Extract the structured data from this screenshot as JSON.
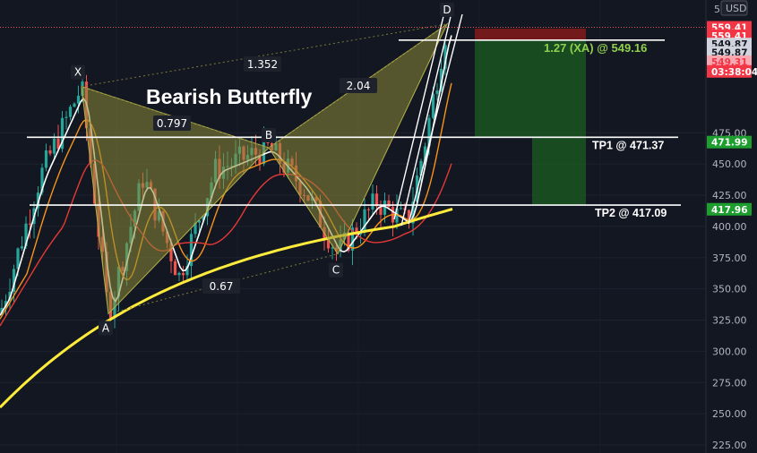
{
  "chart_data": {
    "type": "candlestick",
    "title": "Bearish Butterfly",
    "currency": "USD",
    "y_axis_top_label": "5",
    "ylim": [
      222,
      575
    ],
    "y_ticks": [
      225,
      250,
      275,
      300,
      325,
      350,
      375,
      400,
      425,
      450,
      475
    ],
    "pattern_points": [
      {
        "label": "X",
        "price": 512
      },
      {
        "label": "A",
        "price": 330
      },
      {
        "label": "B",
        "price": 463
      },
      {
        "label": "C",
        "price": 378
      },
      {
        "label": "D",
        "price": 562
      }
    ],
    "ratios": [
      "0.797",
      "1.352",
      "2.04",
      "0.67"
    ],
    "price_tags": [
      {
        "text": "559.41",
        "price": 559.41,
        "style": "red"
      },
      {
        "text": "559.41",
        "price": 552.7,
        "style": "red"
      },
      {
        "text": "549.87",
        "price": 546.0,
        "style": "gray"
      },
      {
        "text": "549.87",
        "price": 539.3,
        "style": "gray"
      },
      {
        "text": "549.31",
        "price": 531.9,
        "style": "pink"
      },
      {
        "text": "03:38:04",
        "price": 524.1,
        "style": "red"
      },
      {
        "text": "471.99",
        "price": 467.5,
        "style": "green"
      },
      {
        "text": "417.96",
        "price": 413.7,
        "style": "green"
      }
    ],
    "levels": [
      {
        "name": "target",
        "price": 549.16,
        "label": "1.27 (XA) @ 549.16"
      },
      {
        "name": "tp1",
        "price": 471.37,
        "label": "TP1 @ 471.37"
      },
      {
        "name": "tp2",
        "price": 417.09,
        "label": "TP2 @ 417.09"
      }
    ],
    "colors": {
      "background": "#131722",
      "pattern_fill": "#8d8b37",
      "candle_up": "#26a69a",
      "candle_down": "#ef5350",
      "ma_fast": "#ffffff",
      "ma_mid": "#f7931a",
      "ma_slow": "#e53935",
      "ma_long": "#ffeb3b"
    }
  }
}
